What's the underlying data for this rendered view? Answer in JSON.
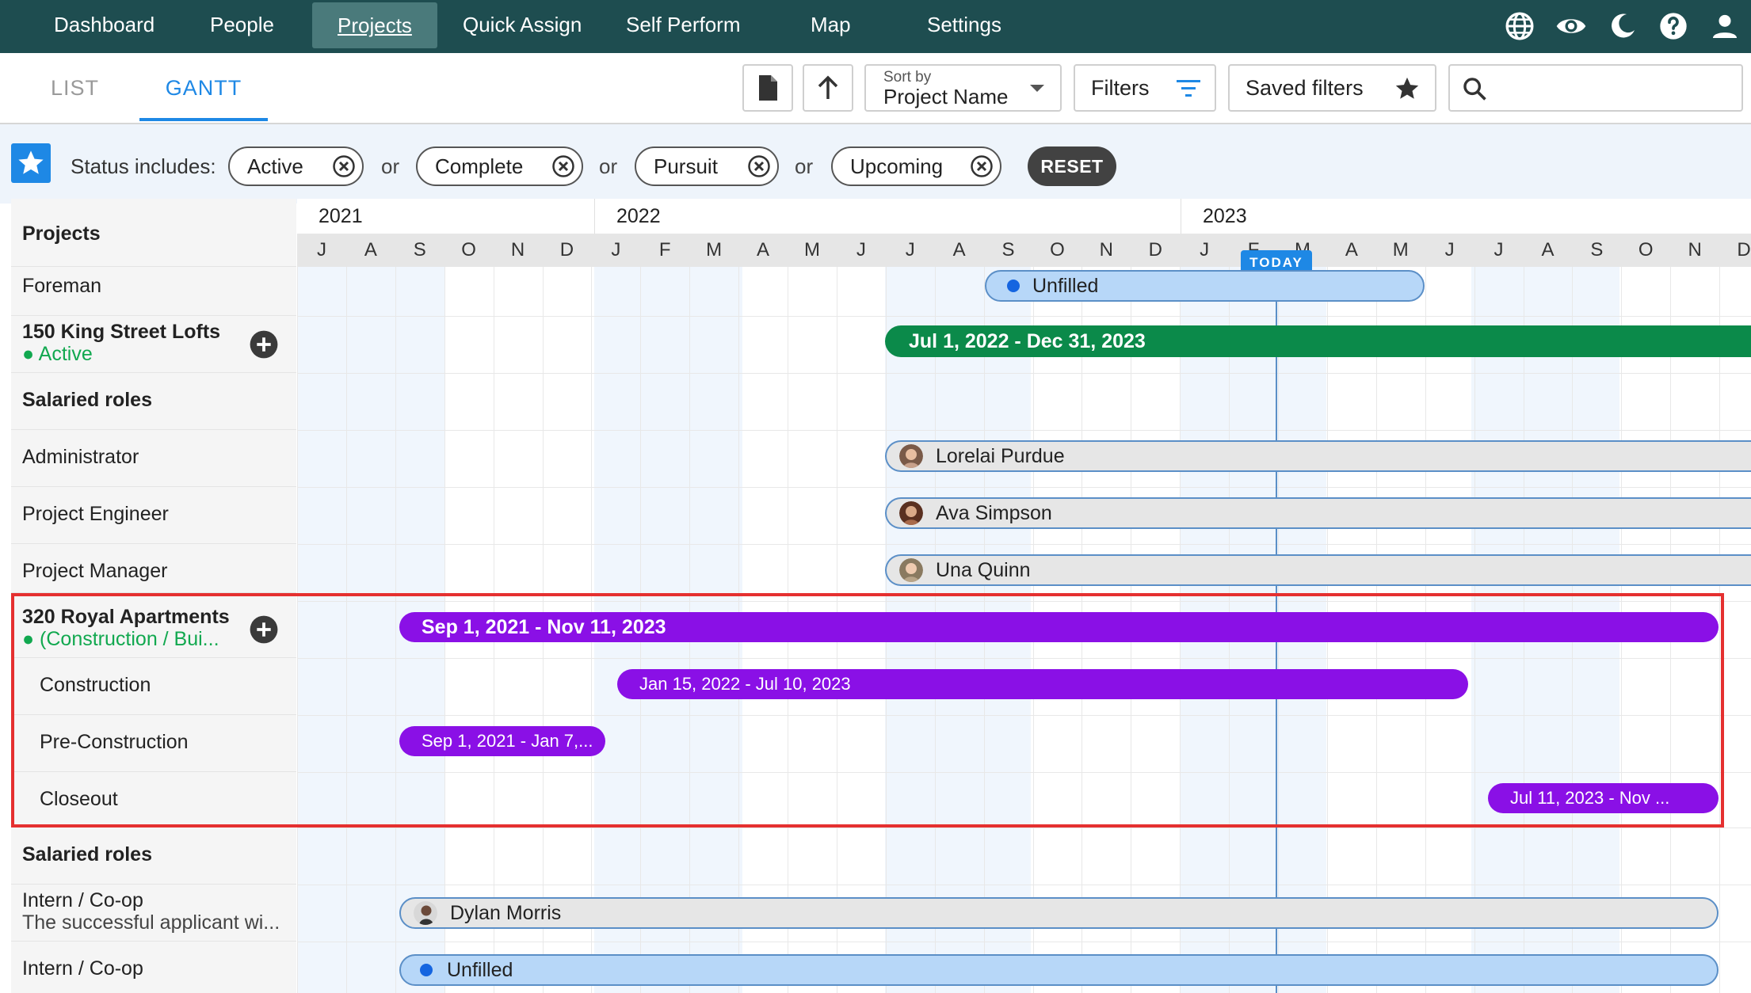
{
  "nav": {
    "items": [
      "Dashboard",
      "People",
      "Projects",
      "Quick Assign",
      "Self Perform",
      "Map",
      "Settings"
    ],
    "active": "Projects",
    "icons": [
      "globe-icon",
      "eye-icon",
      "moon-icon",
      "help-icon",
      "account-icon"
    ]
  },
  "toolbar": {
    "tabs": [
      "LIST",
      "GANTT"
    ],
    "active_tab": "GANTT",
    "sort_label": "Sort by",
    "sort_value": "Project Name",
    "filters_label": "Filters",
    "saved_filters_label": "Saved filters",
    "search_placeholder": ""
  },
  "filter_bar": {
    "label": "Status includes:",
    "chips": [
      "Active",
      "Complete",
      "Pursuit",
      "Upcoming"
    ],
    "separator": "or",
    "reset_label": "RESET"
  },
  "left_panel": {
    "header": "Projects",
    "rows": [
      {
        "title": "Foreman"
      },
      {
        "title": "150 King Street Lofts",
        "subtitle": "Active"
      },
      {
        "title": "Salaried roles"
      },
      {
        "title": "Administrator"
      },
      {
        "title": "Project Engineer"
      },
      {
        "title": "Project Manager"
      },
      {
        "title": "320 Royal Apartments",
        "subtitle": "(Construction / Bui..."
      },
      {
        "title": "Construction"
      },
      {
        "title": "Pre-Construction"
      },
      {
        "title": "Closeout"
      },
      {
        "title": "Salaried roles"
      },
      {
        "title": "Intern / Co-op",
        "subtitle": "The successful applicant wi..."
      },
      {
        "title": "Intern / Co-op"
      }
    ]
  },
  "timeline": {
    "years": [
      "2021",
      "2022",
      "2023"
    ],
    "months": [
      "J",
      "A",
      "S",
      "O",
      "N",
      "D",
      "J",
      "F",
      "M",
      "A",
      "M",
      "J",
      "J",
      "A",
      "S",
      "O",
      "N",
      "D",
      "J",
      "F",
      "M",
      "A",
      "M",
      "J",
      "J",
      "A",
      "S",
      "O",
      "N",
      "D"
    ],
    "today_label": "TODAY",
    "bars": {
      "foreman": "Unfilled",
      "king_street": "Jul 1, 2022 - Dec 31, 2023",
      "administrator": "Lorelai Purdue",
      "project_engineer": "Ava Simpson",
      "project_manager": "Una Quinn",
      "royal": "Sep 1, 2021 - Nov 11, 2023",
      "construction": "Jan 15, 2022 - Jul 10, 2023",
      "pre_construction": "Sep 1, 2021 - Jan 7,...",
      "closeout": "Jul 11, 2023 - Nov ...",
      "intern1": "Dylan Morris",
      "intern2": "Unfilled"
    }
  },
  "colors": {
    "nav_bg": "#1e4d50",
    "accent": "#1e88e5",
    "active_green": "#0b8a4a",
    "project_purple": "#8a10e6",
    "highlight_red": "#e53030"
  }
}
